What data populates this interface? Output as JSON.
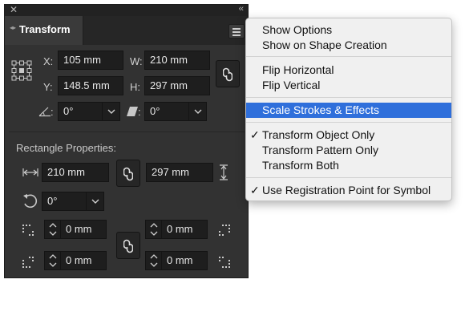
{
  "panel": {
    "title": "Transform",
    "close_glyph": "✕",
    "collapse_glyph": "‹‹",
    "tab_arrows": "◂▸",
    "transform": {
      "x_label": "X:",
      "x_value": "105 mm",
      "w_label": "W:",
      "w_value": "210 mm",
      "y_label": "Y:",
      "y_value": "148.5 mm",
      "h_label": "H:",
      "h_value": "297 mm",
      "rotate_suffix": ":",
      "rotate_value": "0°",
      "shear_suffix": ":",
      "shear_value": "0°"
    },
    "rect": {
      "section_title": "Rectangle Properties:",
      "width_value": "210 mm",
      "height_value": "297 mm",
      "rotation_value": "0°",
      "corner_tl": "0 mm",
      "corner_tr": "0 mm",
      "corner_bl": "0 mm",
      "corner_br": "0 mm"
    }
  },
  "menu": {
    "items": [
      {
        "label": "Show Options",
        "check": ""
      },
      {
        "label": "Show on Shape Creation",
        "check": ""
      },
      {
        "label": "Flip Horizontal",
        "check": ""
      },
      {
        "label": "Flip Vertical",
        "check": ""
      },
      {
        "label": "Scale Strokes & Effects",
        "check": "",
        "highlighted": true
      },
      {
        "label": "Transform Object Only",
        "check": "✓"
      },
      {
        "label": "Transform Pattern Only",
        "check": ""
      },
      {
        "label": "Transform Both",
        "check": ""
      },
      {
        "label": "Use Registration Point for Symbol",
        "check": "✓"
      }
    ]
  },
  "colors": {
    "panel_bg": "#323232",
    "field_bg": "#1e1e1e",
    "menu_bg": "#f0f0f0",
    "menu_highlight": "#2f6fdb"
  }
}
